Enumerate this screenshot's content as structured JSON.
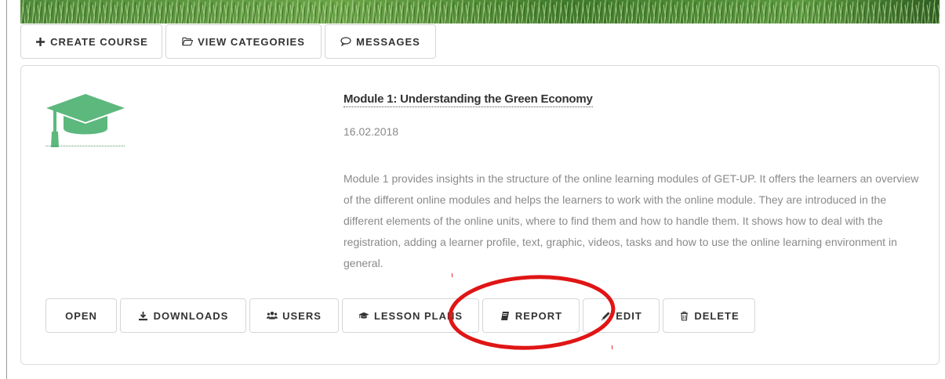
{
  "toolbar": {
    "create_course": {
      "label": "CREATE COURSE",
      "icon": "plus-icon"
    },
    "view_categories": {
      "label": "VIEW CATEGORIES",
      "icon": "folder-open-icon"
    },
    "messages": {
      "label": "MESSAGES",
      "icon": "chat-bubble-icon"
    }
  },
  "course": {
    "icon": "graduation-cap-icon",
    "title": "Module 1: Understanding the Green Economy",
    "date": "16.02.2018",
    "description": "Module 1 provides insights in the structure of the online learning modules of GET-UP. It offers the learners an overview of the different online modules and helps the learners to work with the online module. They are introduced in the different elements of the online units, where to find them and how to handle them. It shows how to deal with the registration, adding a learner profile, text, graphic, videos, tasks and how to use the online learning environment in general."
  },
  "actions": {
    "open": {
      "label": "OPEN"
    },
    "downloads": {
      "label": "DOWNLOADS",
      "icon": "download-icon"
    },
    "users": {
      "label": "USERS",
      "icon": "users-icon"
    },
    "lesson_plans": {
      "label": "LESSON PLANS",
      "icon": "graduation-cap-icon"
    },
    "report": {
      "label": "REPORT",
      "icon": "book-icon"
    },
    "edit": {
      "label": "EDIT",
      "icon": "pencil-icon"
    },
    "delete": {
      "label": "DELETE",
      "icon": "trash-icon"
    }
  },
  "colors": {
    "accent_green": "#5cb87d",
    "annotation_red": "#e01515",
    "text_dark": "#333333",
    "text_muted": "#8a8a8a",
    "border": "#d6d6d6"
  }
}
